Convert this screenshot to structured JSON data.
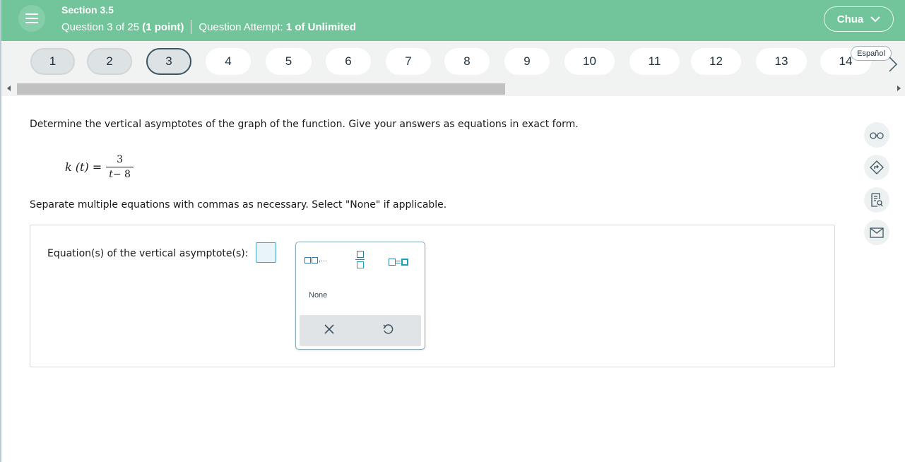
{
  "header": {
    "section": "Section 3.5",
    "question_of": "Question 3 of 25",
    "points": "(1 point)",
    "attempt_label": "Question Attempt:",
    "attempt_value": "1 of Unlimited",
    "user_name": "Chua",
    "bg_color": "#72c49a"
  },
  "nav": {
    "questions": [
      "1",
      "2",
      "3",
      "4",
      "5",
      "6",
      "7",
      "8",
      "9",
      "10",
      "11",
      "12",
      "13",
      "14"
    ],
    "current": "3",
    "language_label": "Español"
  },
  "question": {
    "prompt": "Determine the vertical asymptotes of the graph of the function. Give your answers as equations in exact form.",
    "formula_lhs": "k (t) =",
    "formula_num": "3",
    "formula_den_var": "t",
    "formula_den_rest": "− 8",
    "instructions": "Separate multiple equations with commas as necessary. Select \"None\" if applicable.",
    "answer_label": "Equation(s) of the vertical asymptote(s):",
    "answer_value": ""
  },
  "palette": {
    "list_suffix": ",...",
    "none_label": "None",
    "eq_sign": "="
  },
  "tools": [
    "glasses-icon",
    "navigate-icon",
    "notes-icon",
    "mail-icon"
  ]
}
